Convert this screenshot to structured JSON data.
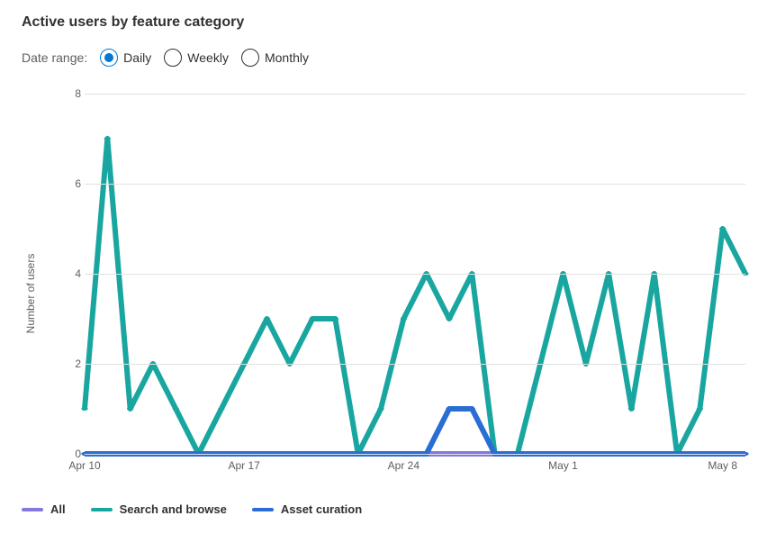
{
  "title": "Active users by feature category",
  "range": {
    "label": "Date range:",
    "options": [
      {
        "value": "daily",
        "label": "Daily",
        "selected": true
      },
      {
        "value": "weekly",
        "label": "Weekly",
        "selected": false
      },
      {
        "value": "monthly",
        "label": "Monthly",
        "selected": false
      }
    ]
  },
  "legend": [
    {
      "name": "All",
      "color": "#8378de"
    },
    {
      "name": "Search and browse",
      "color": "#1aa6a0"
    },
    {
      "name": "Asset curation",
      "color": "#2a6ed4"
    }
  ],
  "chart_data": {
    "type": "line",
    "title": "Active users by feature category",
    "xlabel": "",
    "ylabel": "Number of users",
    "ylim": [
      0,
      8
    ],
    "yticks": [
      0,
      2,
      4,
      6,
      8
    ],
    "x_tick_labels": [
      "Apr 10",
      "Apr 17",
      "Apr 24",
      "May 1",
      "May 8"
    ],
    "x_tick_indices": [
      0,
      7,
      14,
      21,
      28
    ],
    "x_count": 30,
    "series": [
      {
        "name": "All",
        "color": "#8378de",
        "values": [
          0,
          0,
          0,
          0,
          0,
          0,
          0,
          0,
          0,
          0,
          0,
          0,
          0,
          0,
          0,
          0,
          0,
          0,
          0,
          0,
          0,
          0,
          0,
          0,
          0,
          0,
          0,
          0,
          0,
          0
        ]
      },
      {
        "name": "Search and browse",
        "color": "#1aa6a0",
        "values": [
          1,
          7,
          1,
          2,
          1,
          0,
          1,
          2,
          3,
          2,
          3,
          3,
          0,
          1,
          3,
          4,
          3,
          4,
          0,
          0,
          2,
          4,
          2,
          4,
          1,
          4,
          0,
          1,
          5,
          4
        ]
      },
      {
        "name": "Asset curation",
        "color": "#2a6ed4",
        "values": [
          0,
          0,
          0,
          0,
          0,
          0,
          0,
          0,
          0,
          0,
          0,
          0,
          0,
          0,
          0,
          0,
          1,
          1,
          0,
          0,
          0,
          0,
          0,
          0,
          0,
          0,
          0,
          0,
          0,
          0
        ]
      }
    ]
  }
}
